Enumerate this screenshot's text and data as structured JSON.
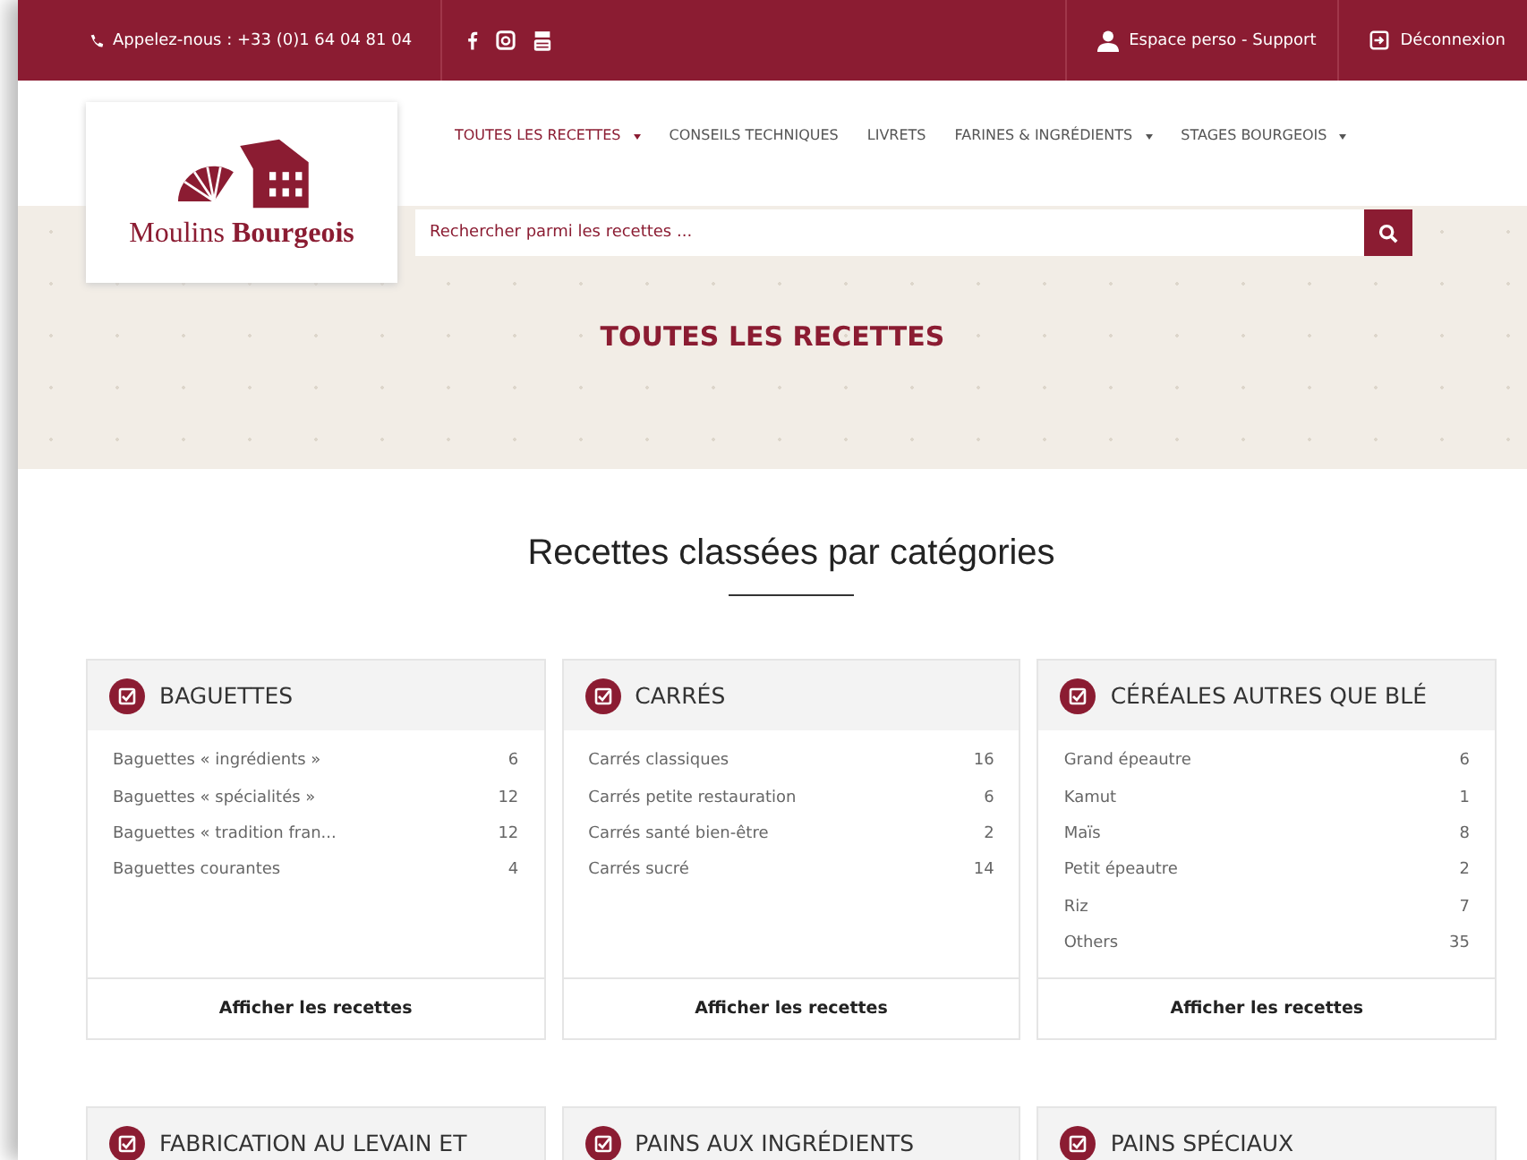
{
  "top_bar": {
    "phone": "Appelez-nous : +33 (0)1 64 04 81 04",
    "account": "Espace perso - Support",
    "logout": "Déconnexion"
  },
  "logo": {
    "name_light": "Moulins",
    "name_bold": "Bourgeois"
  },
  "nav": [
    {
      "label": "TOUTES LES RECETTES",
      "selected": true,
      "dropdown": true
    },
    {
      "label": "CONSEILS TECHNIQUES",
      "selected": false,
      "dropdown": false
    },
    {
      "label": "LIVRETS",
      "selected": false,
      "dropdown": false
    },
    {
      "label": "FARINES & INGRÉDIENTS",
      "selected": false,
      "dropdown": true
    },
    {
      "label": "STAGES BOURGEOIS",
      "selected": false,
      "dropdown": true
    }
  ],
  "search": {
    "placeholder": "Rechercher parmi les recettes ..."
  },
  "hero_title": "TOUTES LES RECETTES",
  "section_title": "Recettes classées par catégories",
  "categories": [
    {
      "title": "BAGUETTES",
      "items": [
        {
          "name": "Baguettes « ingrédients »",
          "count": "6"
        },
        {
          "name": "Baguettes « spécialités »",
          "count": "12"
        },
        {
          "name": "Baguettes « tradition fran...",
          "count": "12"
        },
        {
          "name": "Baguettes courantes",
          "count": "4"
        }
      ],
      "button": "Afficher les recettes"
    },
    {
      "title": "CARRÉS",
      "items": [
        {
          "name": "Carrés classiques",
          "count": "16"
        },
        {
          "name": "Carrés petite restauration",
          "count": "6"
        },
        {
          "name": "Carrés santé bien-être",
          "count": "2"
        },
        {
          "name": "Carrés sucré",
          "count": "14"
        }
      ],
      "button": "Afficher les recettes"
    },
    {
      "title": "CÉRÉALES AUTRES QUE BLÉ",
      "items": [
        {
          "name": "Grand épeautre",
          "count": "6"
        },
        {
          "name": "Kamut",
          "count": "1"
        },
        {
          "name": "Maïs",
          "count": "8"
        },
        {
          "name": "Petit épeautre",
          "count": "2"
        },
        {
          "name": "Riz",
          "count": "7"
        },
        {
          "name": "Others",
          "count": "35"
        }
      ],
      "button": "Afficher les recettes"
    },
    {
      "title": "FABRICATION AU LEVAIN ET"
    },
    {
      "title": "PAINS AUX INGRÉDIENTS"
    },
    {
      "title": "PAINS SPÉCIAUX"
    }
  ]
}
